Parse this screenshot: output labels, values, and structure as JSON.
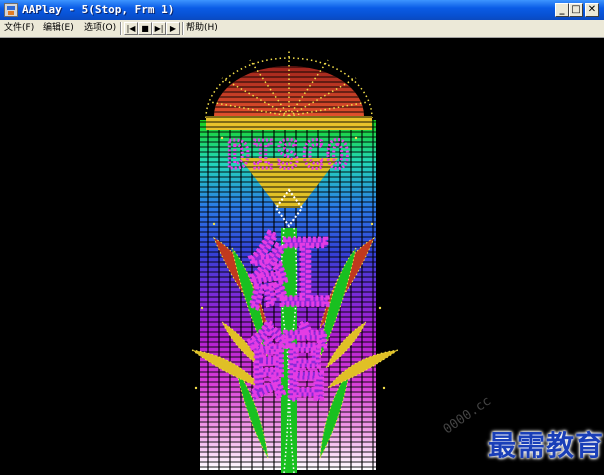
{
  "window": {
    "title": "AAPlay - 5(Stop, Frm 1)",
    "minimize_glyph": "_",
    "maximize_glyph": "□",
    "close_glyph": "✕"
  },
  "menu": {
    "file": "文件(F)",
    "edit": "编辑(E)",
    "options": "选项(O)",
    "help": "帮助(H)"
  },
  "toolbar": {
    "rewind": "|◀",
    "stop": "■",
    "step": "▶|",
    "play": "▶"
  },
  "artwork": {
    "sign_word": "DISCO",
    "chinese_chars": [
      "紅",
      "館"
    ],
    "colors": {
      "fan_top": "#c0392b",
      "dots": "#f5e04a",
      "magenta": "#e43ce4",
      "purple_outline": "#8b2ad8"
    }
  },
  "watermark": {
    "text": "最需教育",
    "url_fragment": "0000.cc"
  }
}
